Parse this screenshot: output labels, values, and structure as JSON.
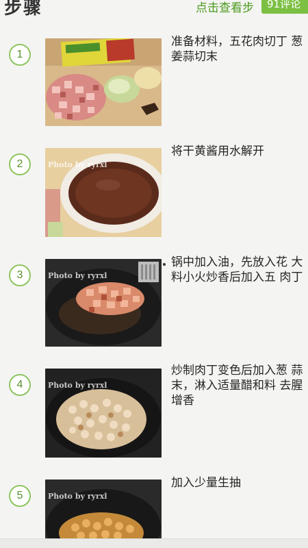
{
  "header": {
    "title": "步骤",
    "view_link": "点击查看步",
    "comment_badge": "91评论"
  },
  "steps": [
    {
      "number": "1",
      "text": "准备材料，五花肉切丁 葱姜蒜切末",
      "photo": "ingredients-photo",
      "watermark": ""
    },
    {
      "number": "2",
      "text": "将干黄酱用水解开",
      "photo": "sauce-bowl-photo",
      "watermark": "Photo by ryrxl"
    },
    {
      "number": "3",
      "text": "锅中加入油，先放入花 大料小火炒香后加入五 肉丁",
      "photo": "wok-meat-photo",
      "watermark": "Photo by ryrxl"
    },
    {
      "number": "4",
      "text": "炒制肉丁变色后加入葱 蒜末，淋入适量醋和料 去腥增香",
      "photo": "stir-fry-photo",
      "watermark": "Photo by ryrxl"
    },
    {
      "number": "5",
      "text": "加入少量生抽",
      "photo": "soy-sauce-photo",
      "watermark": "Photo by ryrxl"
    }
  ]
}
